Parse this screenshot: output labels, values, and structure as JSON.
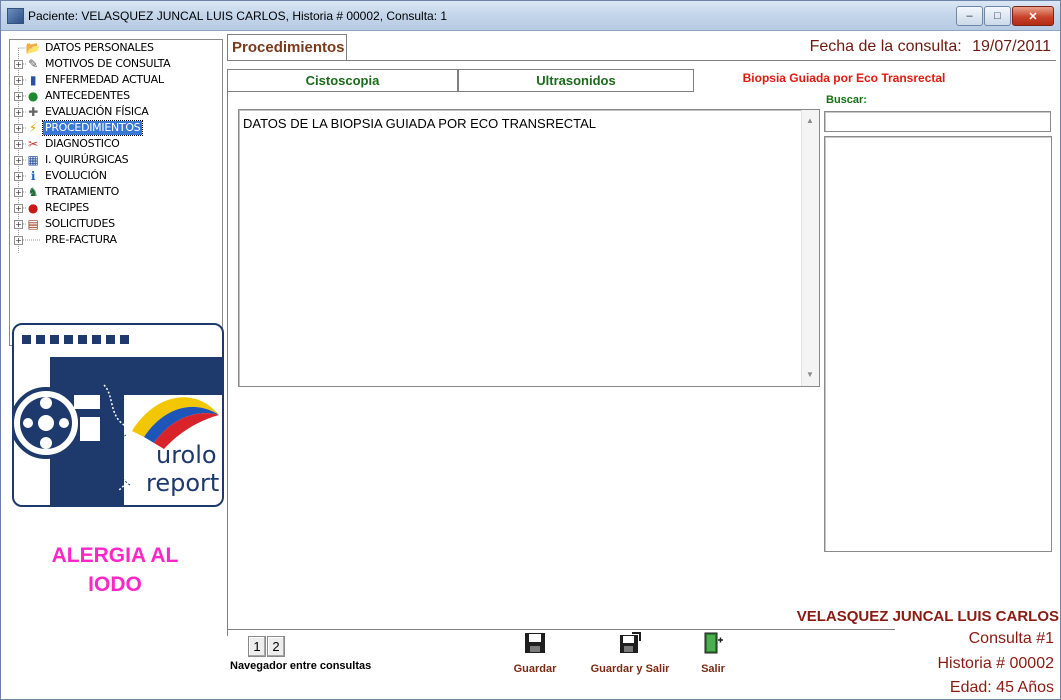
{
  "window": {
    "title": "Paciente: VELASQUEZ JUNCAL LUIS CARLOS, Historia # 00002, Consulta: 1",
    "buttons": {
      "minimize": "–",
      "maximize": "□",
      "close": "✕"
    }
  },
  "tree": {
    "items": [
      {
        "label": "DATOS PERSONALES",
        "icon": "folder-open-icon",
        "glyph": "📂",
        "expandable": false,
        "selected": false
      },
      {
        "label": "MOTIVOS DE CONSULTA",
        "icon": "pen-icon",
        "glyph": "✎",
        "expandable": true,
        "selected": false
      },
      {
        "label": "ENFERMEDAD ACTUAL",
        "icon": "bar-chart-icon",
        "glyph": "▮",
        "expandable": true,
        "selected": false
      },
      {
        "label": "ANTECEDENTES",
        "icon": "globe-icon",
        "glyph": "●",
        "expandable": true,
        "selected": false
      },
      {
        "label": "EVALUACIÓN FÍSICA",
        "icon": "physician-icon",
        "glyph": "✚",
        "expandable": true,
        "selected": false
      },
      {
        "label": "PROCEDIMIENTOS",
        "icon": "lightning-icon",
        "glyph": "⚡",
        "expandable": true,
        "selected": true
      },
      {
        "label": "DIAGNOSTICO",
        "icon": "tools-icon",
        "glyph": "✂",
        "expandable": true,
        "selected": false
      },
      {
        "label": "I. QUIRÚRGICAS",
        "icon": "grid-icon",
        "glyph": "▦",
        "expandable": true,
        "selected": false
      },
      {
        "label": "EVOLUCIÓN",
        "icon": "info-icon",
        "glyph": "ℹ",
        "expandable": true,
        "selected": false
      },
      {
        "label": "TRATAMIENTO",
        "icon": "person-icon",
        "glyph": "♞",
        "expandable": true,
        "selected": false
      },
      {
        "label": "RECIPES",
        "icon": "apple-icon",
        "glyph": "●",
        "expandable": true,
        "selected": false
      },
      {
        "label": "SOLICITUDES",
        "icon": "document-icon",
        "glyph": "▤",
        "expandable": true,
        "selected": false
      },
      {
        "label": "PRE-FACTURA",
        "icon": "blank-icon",
        "glyph": "",
        "expandable": true,
        "selected": false
      }
    ]
  },
  "logo": {
    "line1": "urolo",
    "line2": "report"
  },
  "allergy": {
    "line1": "ALERGIA AL",
    "line2": "IODO",
    "color": "#ff26c8"
  },
  "main": {
    "tab": "Procedimientos",
    "fecha_label": "Fecha de la consulta:",
    "fecha_value": "19/07/2011",
    "subtabs": [
      {
        "label": "Cistoscopia",
        "active": false
      },
      {
        "label": "Ultrasonidos",
        "active": false
      },
      {
        "label": "Biopsia Guiada por Eco Transrectal",
        "active": true
      }
    ],
    "editor_text": "DATOS DE LA BIOPSIA GUIADA POR ECO TRANSRECTAL"
  },
  "search": {
    "label": "Buscar:",
    "value": ""
  },
  "patient": {
    "name": "VELASQUEZ JUNCAL LUIS CARLOS",
    "consulta": "Consulta #1",
    "historia": "Historia # 00002",
    "edad": "Edad: 45 Años"
  },
  "navigator": {
    "pages": [
      "1",
      "2"
    ],
    "caption": "Navegador entre consultas"
  },
  "toolbar": {
    "guardar": "Guardar",
    "guardar_salir": "Guardar y Salir",
    "salir": "Salir"
  },
  "colors": {
    "accent_dark_red": "#8a1b12",
    "tab_green": "#1a6b1a",
    "active_tab_red": "#e11a10",
    "selection_blue": "#3a78d8"
  }
}
